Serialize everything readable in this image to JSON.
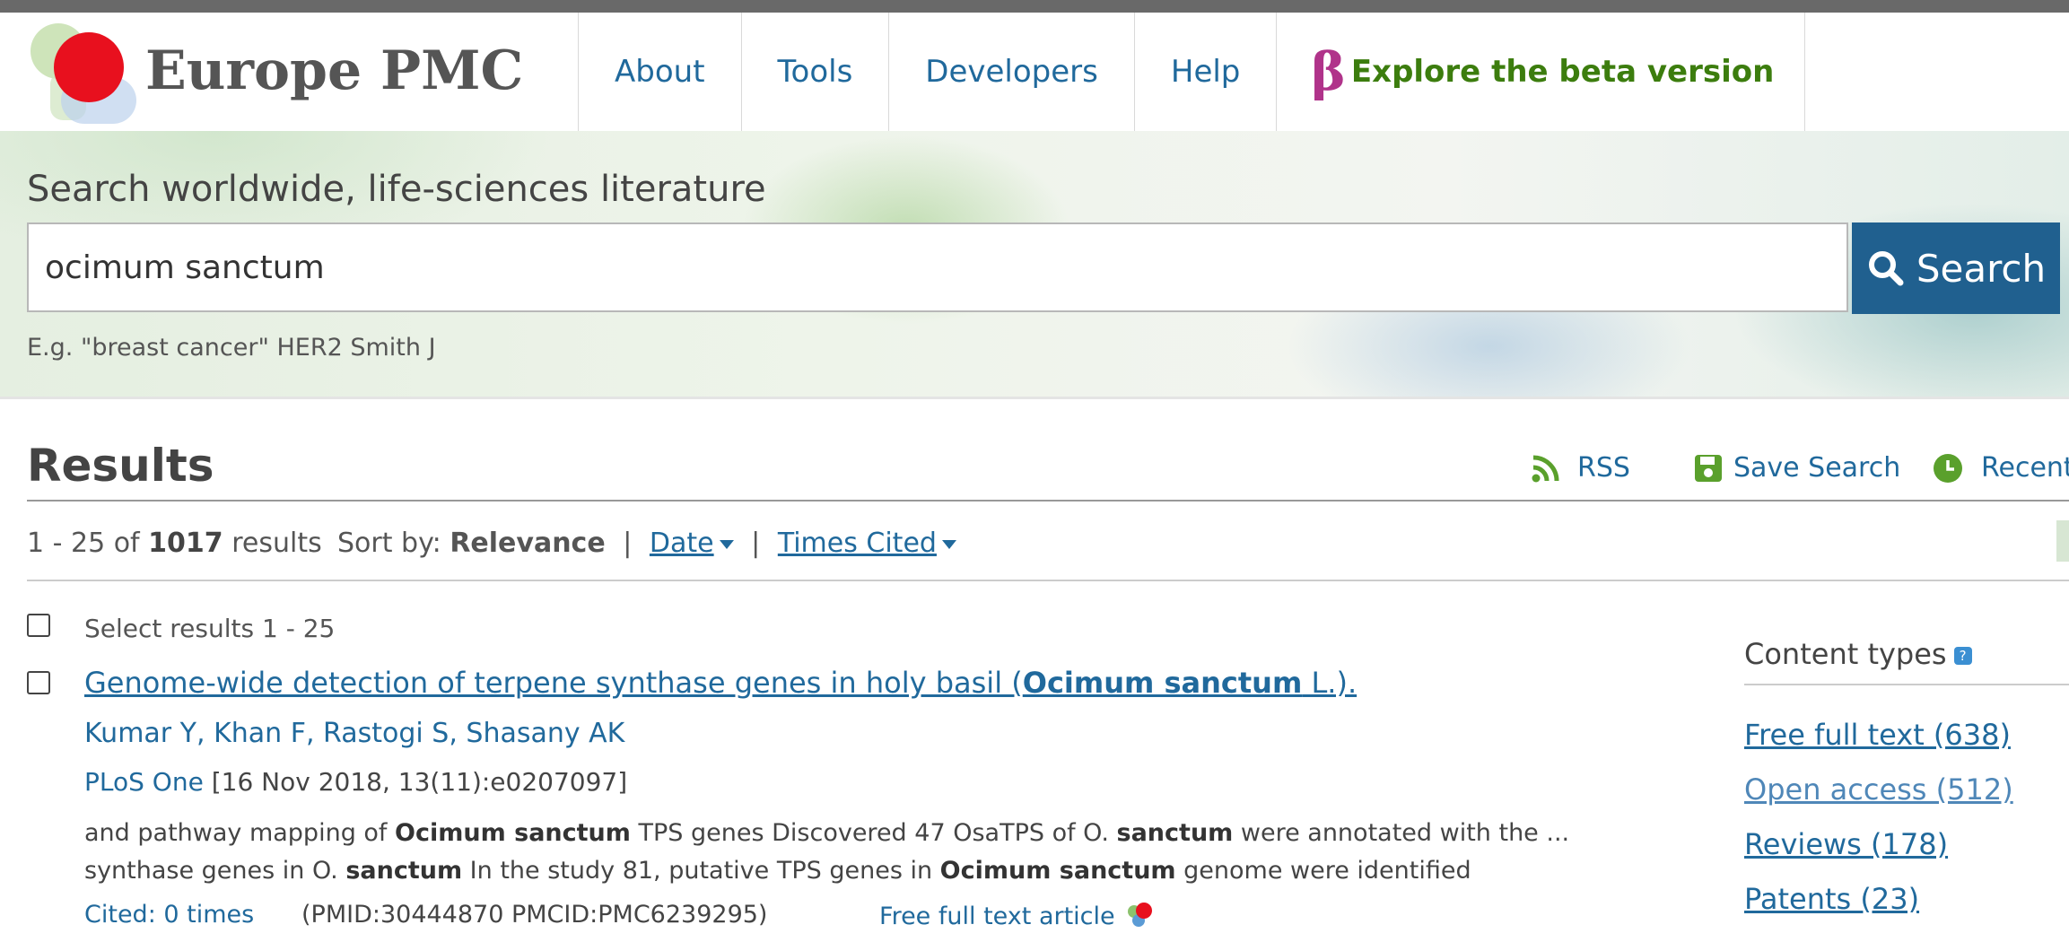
{
  "header": {
    "logo_text": "Europe PMC",
    "nav": [
      "About",
      "Tools",
      "Developers",
      "Help"
    ],
    "beta_symbol": "β",
    "beta_label": "Explore the beta version"
  },
  "search": {
    "title": "Search worldwide, life-sciences literature",
    "query": "ocimum sanctum",
    "button": "Search",
    "example": "E.g. \"breast cancer\" HER2 Smith J"
  },
  "results": {
    "heading": "Results",
    "actions": {
      "rss": "RSS",
      "save": "Save Search",
      "recent": "Recent"
    },
    "range": "1 - 25 of",
    "total": "1017",
    "results_word": "results",
    "sort_label": "Sort by:",
    "sort_selected": "Relevance",
    "sort_date": "Date",
    "sort_cited": "Times Cited",
    "sep": "|",
    "select_label": "Select results 1 - 25"
  },
  "article": {
    "title_pre": "Genome-wide detection of terpene synthase genes in holy basil (",
    "title_bold": "Ocimum sanctum",
    "title_post": " L.).",
    "authors": [
      "Kumar Y",
      "Khan F",
      "Rastogi S",
      "Shasany AK"
    ],
    "journal": "PLoS One",
    "citation": " [16 Nov 2018, 13(11):e0207097]",
    "snippet1": [
      "and pathway mapping of ",
      "Ocimum sanctum",
      " TPS genes Discovered 47 OsaTPS of O. ",
      "sanctum",
      " were annotated with the ..."
    ],
    "snippet2": [
      "synthase genes in O. ",
      "sanctum",
      " In the study 81, putative TPS genes in ",
      "Ocimum sanctum",
      " genome were identified"
    ],
    "cited": "Cited: 0 times",
    "ids": "(PMID:30444870 PMCID:PMC6239295)",
    "fulltext": "Free full text article"
  },
  "sidebar": {
    "title": "Content types",
    "help": "?",
    "links": [
      "Free full text (638)",
      "Open access (512)",
      "Reviews (178)",
      "Patents (23)"
    ]
  },
  "colors": {
    "link": "#20699c",
    "search_button": "#20608f",
    "beta": "#3c7d0e",
    "beta_symbol": "#b0338a",
    "logo_dot": "#e8101e",
    "icons": "#5aa02c"
  }
}
